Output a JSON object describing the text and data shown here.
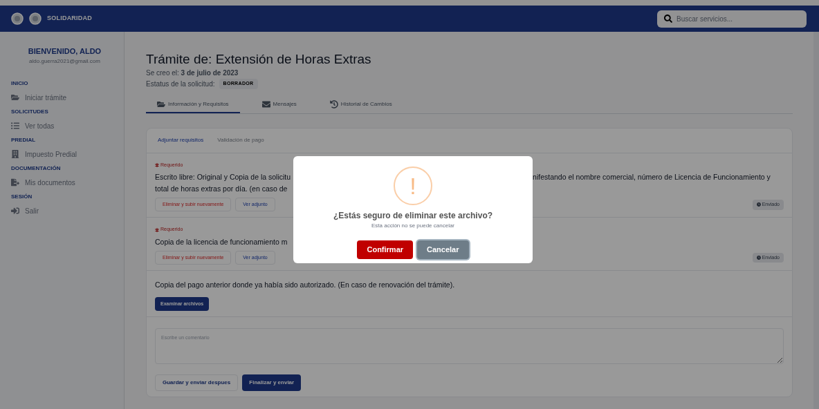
{
  "header": {
    "logo_text": "SOLIDARIDAD",
    "search": {
      "placeholder": "Buscar servicios..."
    }
  },
  "sidebar": {
    "welcome": "BIENVENIDO, ALDO",
    "email": "aldo.guerra2021@gmail.com",
    "sections": [
      {
        "title": "INICIO",
        "items": [
          {
            "label": "Iniciar trámite",
            "kind": "folder"
          }
        ]
      },
      {
        "title": "SOLICITUDES",
        "items": [
          {
            "label": "Ver todas",
            "kind": "list"
          }
        ]
      },
      {
        "title": "PREDIAL",
        "items": [
          {
            "label": "Impuesto Predial",
            "kind": "building"
          }
        ]
      },
      {
        "title": "DOCUMENTACIÓN",
        "items": [
          {
            "label": "Mis documentos",
            "kind": "file"
          }
        ]
      },
      {
        "title": "SESIÓN",
        "items": [
          {
            "label": "Salir",
            "kind": "exit"
          }
        ]
      }
    ]
  },
  "page": {
    "title": "Trámite de: Extensión de Horas Extras",
    "created_label": "Se creo el:",
    "created_date": "3 de julio de 2023",
    "status_label": "Estatus de la solicitud:",
    "status": "BORRADOR",
    "tabs": [
      {
        "label": "Información y Requisitos",
        "kind": "folder",
        "selected": true
      },
      {
        "label": "Mensajes",
        "kind": "mail",
        "selected": false
      },
      {
        "label": "Historial de Cambios",
        "kind": "history",
        "selected": false
      }
    ],
    "subtabs": [
      {
        "label": "Adjuntar requisitos",
        "selected": true
      },
      {
        "label": "Validación de pago",
        "selected": false
      }
    ],
    "requirements": [
      {
        "kind": "sent",
        "required": "Requerido",
        "text_left": [
          "Escrito libre: Original y Copia de la solicitu",
          "total de horas extras por día. (en caso de"
        ],
        "text_right": [
          "nifestando el nombre comercial, número de Licencia de Funcionamiento y"
        ],
        "delete": "Eliminar y subir nuevamente",
        "view": "Ver adjunto",
        "badge": "Enviado"
      },
      {
        "kind": "sent",
        "required": "Requerido",
        "text_left": [
          "Copia de la licencia de funcionamiento m"
        ],
        "delete": "Eliminar y subir nuevamente",
        "view": "Ver adjunto",
        "badge": "Enviado"
      },
      {
        "kind": "upload",
        "text_left": [
          "Copia del pago anterior donde ya había sido autorizado. (En caso de renovación del trámite)."
        ],
        "upload": "Examinar archivos"
      }
    ],
    "comment": {
      "placeholder": "Escribe un comentario"
    },
    "save": "Guardar y enviar despues",
    "finish": "Finalizar y enviar"
  },
  "dialog": {
    "icon": "!",
    "title": "¿Estás seguro de eliminar este archivo?",
    "message": "Esta acción no se puede cancelar",
    "confirm": "Confirmar",
    "cancel": "Cancelar"
  }
}
